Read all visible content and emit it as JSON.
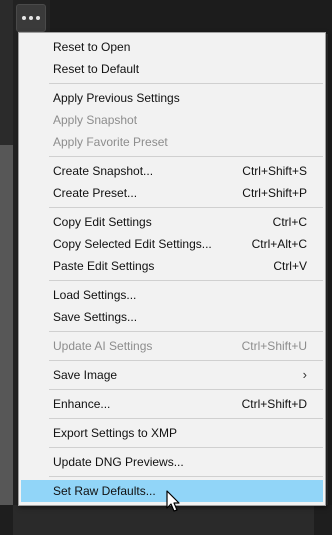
{
  "menu": {
    "items": [
      {
        "label": "Reset to Open",
        "shortcut": "",
        "enabled": true
      },
      {
        "label": "Reset to Default",
        "shortcut": "",
        "enabled": true
      },
      {
        "label": "Apply Previous Settings",
        "shortcut": "",
        "enabled": true
      },
      {
        "label": "Apply Snapshot",
        "shortcut": "",
        "enabled": false
      },
      {
        "label": "Apply Favorite Preset",
        "shortcut": "",
        "enabled": false
      },
      {
        "label": "Create Snapshot...",
        "shortcut": "Ctrl+Shift+S",
        "enabled": true
      },
      {
        "label": "Create Preset...",
        "shortcut": "Ctrl+Shift+P",
        "enabled": true
      },
      {
        "label": "Copy Edit Settings",
        "shortcut": "Ctrl+C",
        "enabled": true
      },
      {
        "label": "Copy Selected Edit Settings...",
        "shortcut": "Ctrl+Alt+C",
        "enabled": true
      },
      {
        "label": "Paste Edit Settings",
        "shortcut": "Ctrl+V",
        "enabled": true
      },
      {
        "label": "Load Settings...",
        "shortcut": "",
        "enabled": true
      },
      {
        "label": "Save Settings...",
        "shortcut": "",
        "enabled": true
      },
      {
        "label": "Update AI Settings",
        "shortcut": "Ctrl+Shift+U",
        "enabled": false
      },
      {
        "label": "Save Image",
        "shortcut": "",
        "enabled": true,
        "submenu": true
      },
      {
        "label": "Enhance...",
        "shortcut": "Ctrl+Shift+D",
        "enabled": true
      },
      {
        "label": "Export Settings to XMP",
        "shortcut": "",
        "enabled": true
      },
      {
        "label": "Update DNG Previews...",
        "shortcut": "",
        "enabled": true
      },
      {
        "label": "Set Raw Defaults...",
        "shortcut": "",
        "enabled": true,
        "highlighted": true
      }
    ],
    "submenu_arrow": "›"
  },
  "colors": {
    "menu_background": "#f2f2f2",
    "highlight": "#91d5f8",
    "disabled_text": "#8d8d8d"
  },
  "icons": {
    "more_button": "more-horizontal-icon",
    "cursor": "mouse-pointer-icon"
  }
}
